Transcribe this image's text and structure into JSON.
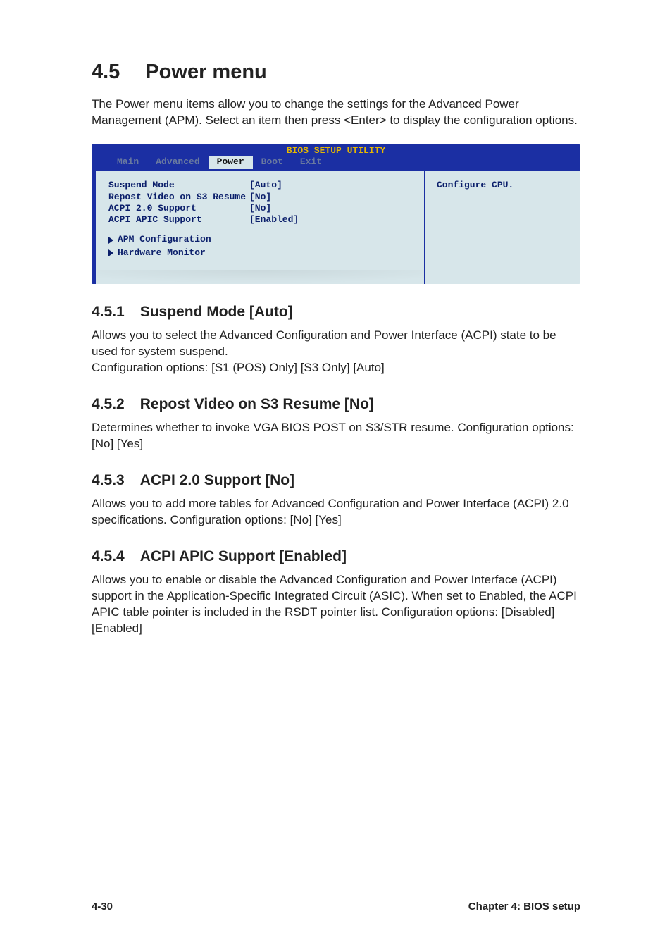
{
  "section": {
    "number": "4.5",
    "title": "Power menu",
    "intro": "The Power menu items allow you to change the settings for the Advanced Power Management (APM). Select an item then press <Enter> to display the configuration options."
  },
  "bios": {
    "title": "BIOS SETUP UTILITY",
    "tabs": [
      {
        "label": "Main",
        "active": false
      },
      {
        "label": "Advanced",
        "active": false
      },
      {
        "label": "Power",
        "active": true
      },
      {
        "label": "Boot",
        "active": false
      },
      {
        "label": "Exit",
        "active": false
      }
    ],
    "items": [
      {
        "label": "Suspend Mode",
        "value": "[Auto]"
      },
      {
        "label": "Repost Video on S3 Resume",
        "value": "[No]"
      },
      {
        "label": "ACPI 2.0 Support",
        "value": "[No]"
      },
      {
        "label": "ACPI APIC Support",
        "value": "[Enabled]"
      }
    ],
    "submenus": [
      {
        "label": "APM Configuration"
      },
      {
        "label": "Hardware Monitor"
      }
    ],
    "help": "Configure CPU."
  },
  "subs": [
    {
      "num": "4.5.1",
      "title": "Suspend Mode [Auto]",
      "body": "Allows you to select the Advanced Configuration and Power Interface (ACPI) state to be used for system suspend.\nConfiguration options: [S1 (POS) Only] [S3 Only] [Auto]"
    },
    {
      "num": "4.5.2",
      "title": "Repost Video on S3 Resume [No]",
      "body": "Determines whether to invoke VGA BIOS POST on S3/STR resume. Configuration options: [No] [Yes]"
    },
    {
      "num": "4.5.3",
      "title": "ACPI 2.0 Support [No]",
      "body": "Allows you to add more tables for Advanced Configuration and Power Interface (ACPI) 2.0 specifications. Configuration options: [No] [Yes]"
    },
    {
      "num": "4.5.4",
      "title": "ACPI APIC Support [Enabled]",
      "body": "Allows you to enable or disable the Advanced Configuration and Power Interface (ACPI) support in the Application-Specific Integrated Circuit (ASIC). When set to Enabled, the ACPI APIC table pointer is included in the RSDT pointer list. Configuration options: [Disabled] [Enabled]"
    }
  ],
  "footer": {
    "page": "4-30",
    "chapter": "Chapter 4: BIOS setup"
  }
}
